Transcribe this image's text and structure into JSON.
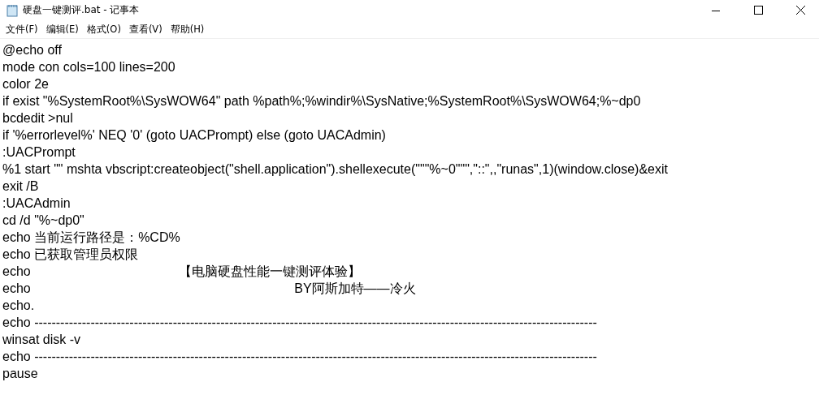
{
  "window": {
    "title": "硬盘一键测评.bat - 记事本"
  },
  "menu": [
    "文件(F)",
    "编辑(E)",
    "格式(O)",
    "查看(V)",
    "帮助(H)"
  ],
  "editor": {
    "lines": [
      "@echo off",
      "mode con cols=100 lines=200",
      "color 2e",
      "if exist \"%SystemRoot%\\SysWOW64\" path %path%;%windir%\\SysNative;%SystemRoot%\\SysWOW64;%~dp0",
      "bcdedit >nul",
      "if '%errorlevel%' NEQ '0' (goto UACPrompt) else (goto UACAdmin)",
      ":UACPrompt",
      "%1 start \"\" mshta vbscript:createobject(\"shell.application\").shellexecute(\"\"\"%~0\"\"\",\"::\",,\"runas\",1)(window.close)&exit",
      "exit /B",
      ":UACAdmin",
      "cd /d \"%~dp0\"",
      "echo 当前运行路径是：%CD%",
      "echo 已获取管理员权限",
      "echo                                         【电脑硬盘性能一键测评体验】",
      "echo                                                                         BY阿斯加特——冷火",
      "echo.",
      "echo ----------------------------------------------------------------------------------------------------------------------------------",
      "winsat disk -v",
      "echo ----------------------------------------------------------------------------------------------------------------------------------",
      "pause"
    ]
  }
}
